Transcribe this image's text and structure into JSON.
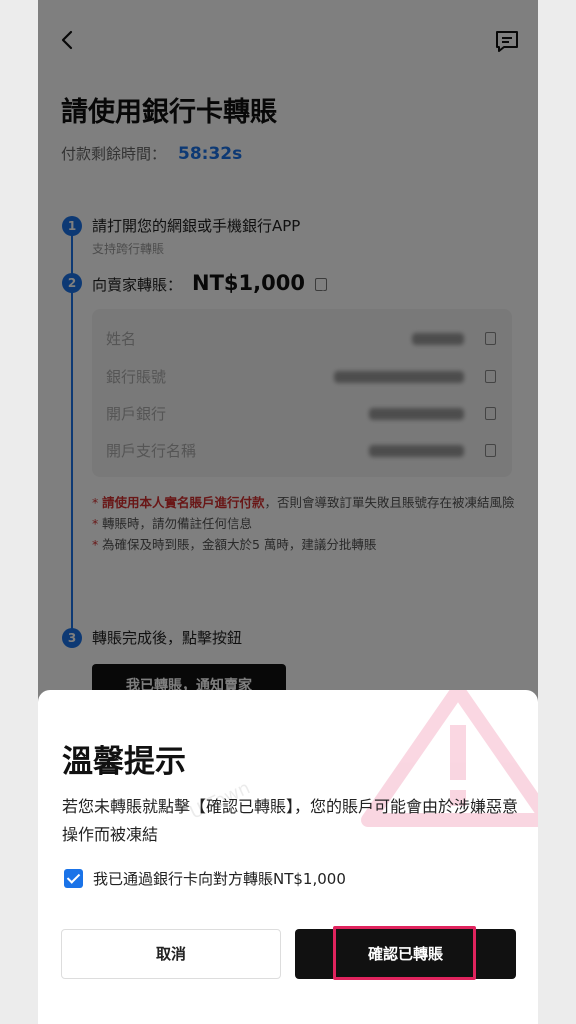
{
  "page": {
    "title": "請使用銀行卡轉賬",
    "timer_label": "付款剩餘時間：",
    "timer_value": "58:32s"
  },
  "steps": [
    {
      "number": "1",
      "title": "請打開您的網銀或手機銀行APP",
      "subtitle": "支持跨行轉賬"
    },
    {
      "number": "2",
      "title": "向賣家轉賬：",
      "amount": "NT$1,000"
    },
    {
      "number": "3",
      "title": "轉賬完成後，點擊按鈕"
    }
  ],
  "account_info": [
    {
      "label": "姓名"
    },
    {
      "label": "銀行賬號"
    },
    {
      "label": "開戶銀行"
    },
    {
      "label": "開戶支行名稱"
    }
  ],
  "notes": {
    "note1_red": "請使用本人實名賬戶進行付款",
    "note1_rest": "，否則會導致訂單失敗且賬號存在被凍結風險",
    "note2": "轉賬時，請勿備註任何信息",
    "note3": "為確保及時到賬，金額大於5 萬時，建議分批轉賬"
  },
  "notify_button": "我已轉賬，通知賣家",
  "watermark": "U.Town",
  "dialog": {
    "title": "溫馨提示",
    "message": "若您未轉賬就點擊【確認已轉賬】，您的賬戶可能會由於涉嫌惡意操作而被凍結",
    "checkbox_label": "我已通過銀行卡向對方轉賬NT$1,000",
    "checkbox_checked": true,
    "cancel_label": "取消",
    "confirm_label": "確認已轉賬"
  },
  "colors": {
    "accent": "#1a73e8",
    "warning": "#d32f2f",
    "highlight": "#e0245e"
  }
}
